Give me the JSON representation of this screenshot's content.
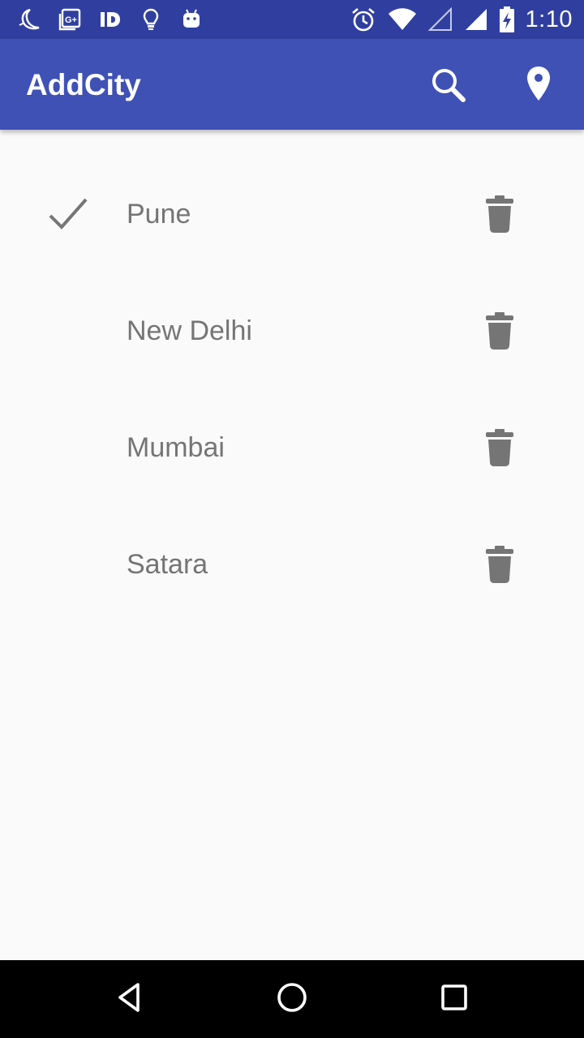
{
  "status_bar": {
    "time": "1:10",
    "left_icons": [
      "moon-icon",
      "google-plus-icon",
      "id-icon",
      "lightbulb-icon",
      "android-icon"
    ],
    "right_icons": [
      "alarm-icon",
      "wifi-icon",
      "signal-icon",
      "battery-charging-icon"
    ]
  },
  "app_bar": {
    "title": "AddCity",
    "actions": [
      "search-icon",
      "location-icon"
    ]
  },
  "cities": [
    {
      "name": "Pune",
      "selected": true
    },
    {
      "name": "New Delhi",
      "selected": false
    },
    {
      "name": "Mumbai",
      "selected": false
    },
    {
      "name": "Satara",
      "selected": false
    }
  ],
  "nav_bar": {
    "buttons": [
      "back-icon",
      "home-icon",
      "recents-icon"
    ]
  },
  "colors": {
    "status_bar": "#303f9f",
    "app_bar": "#3f51b5",
    "background": "#fafafa",
    "text": "#757575",
    "icon": "#757575",
    "nav_bar": "#000000"
  }
}
